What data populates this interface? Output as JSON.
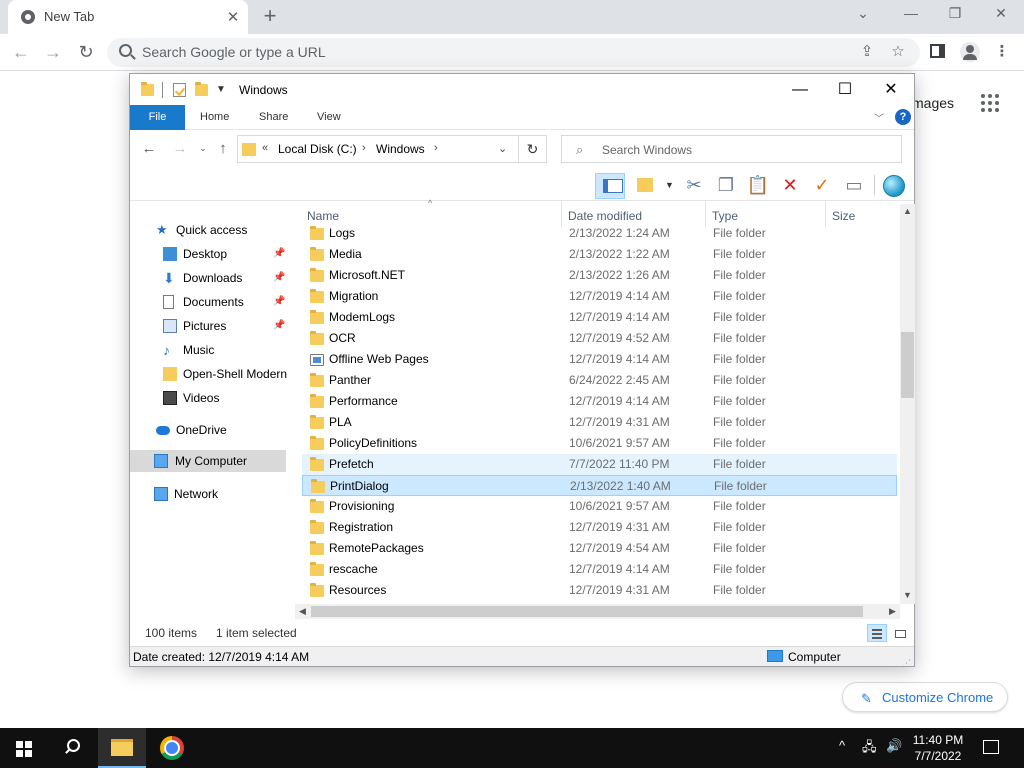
{
  "chrome": {
    "tab_title": "New Tab",
    "omnibox_placeholder": "Search Google or type a URL",
    "images_link": "mages",
    "customize_label": "Customize Chrome"
  },
  "explorer": {
    "title": "Windows",
    "ribbon_tabs": [
      "File",
      "Home",
      "Share",
      "View"
    ],
    "breadcrumb": [
      "Local Disk (C:)",
      "Windows"
    ],
    "search_placeholder": "Search Windows",
    "nav": {
      "quick_access": "Quick access",
      "items": [
        "Desktop",
        "Downloads",
        "Documents",
        "Pictures",
        "Music",
        "Open-Shell Modern",
        "Videos"
      ],
      "onedrive": "OneDrive",
      "my_computer": "My Computer",
      "network": "Network"
    },
    "columns": [
      "Name",
      "Date modified",
      "Type",
      "Size"
    ],
    "files": [
      {
        "name": "Logs",
        "date": "2/13/2022 1:24 AM",
        "type": "File folder"
      },
      {
        "name": "Media",
        "date": "2/13/2022 1:22 AM",
        "type": "File folder"
      },
      {
        "name": "Microsoft.NET",
        "date": "2/13/2022 1:26 AM",
        "type": "File folder"
      },
      {
        "name": "Migration",
        "date": "12/7/2019 4:14 AM",
        "type": "File folder"
      },
      {
        "name": "ModemLogs",
        "date": "12/7/2019 4:14 AM",
        "type": "File folder"
      },
      {
        "name": "OCR",
        "date": "12/7/2019 4:52 AM",
        "type": "File folder"
      },
      {
        "name": "Offline Web Pages",
        "date": "12/7/2019 4:14 AM",
        "type": "File folder"
      },
      {
        "name": "Panther",
        "date": "6/24/2022 2:45 AM",
        "type": "File folder"
      },
      {
        "name": "Performance",
        "date": "12/7/2019 4:14 AM",
        "type": "File folder"
      },
      {
        "name": "PLA",
        "date": "12/7/2019 4:31 AM",
        "type": "File folder"
      },
      {
        "name": "PolicyDefinitions",
        "date": "10/6/2021 9:57 AM",
        "type": "File folder"
      },
      {
        "name": "Prefetch",
        "date": "7/7/2022 11:40 PM",
        "type": "File folder"
      },
      {
        "name": "PrintDialog",
        "date": "2/13/2022 1:40 AM",
        "type": "File folder"
      },
      {
        "name": "Provisioning",
        "date": "10/6/2021 9:57 AM",
        "type": "File folder"
      },
      {
        "name": "Registration",
        "date": "12/7/2019 4:31 AM",
        "type": "File folder"
      },
      {
        "name": "RemotePackages",
        "date": "12/7/2019 4:54 AM",
        "type": "File folder"
      },
      {
        "name": "rescache",
        "date": "12/7/2019 4:14 AM",
        "type": "File folder"
      },
      {
        "name": "Resources",
        "date": "12/7/2019 4:31 AM",
        "type": "File folder"
      }
    ],
    "status_count": "100 items",
    "status_selected": "1 item selected",
    "footer_info": "Date created: 12/7/2019 4:14 AM",
    "footer_location": "Computer"
  },
  "taskbar": {
    "time": "11:40 PM",
    "date": "7/7/2022"
  },
  "icons": {
    "chrome_tab_favicon": "chrome-icon",
    "explorer_taskbar": "file-explorer-icon",
    "chrome_taskbar": "chrome-icon",
    "help": "help-icon",
    "refresh": "refresh-icon",
    "globe": "globe-icon"
  },
  "colors": {
    "ribbon_file": "#1979ca",
    "selection": "#cce8ff",
    "selection_border": "#99d1ff",
    "hover": "#e5f3ff",
    "folder": "#f6cc5d",
    "chrome_link": "#1a73e8",
    "taskbar": "#101010"
  }
}
